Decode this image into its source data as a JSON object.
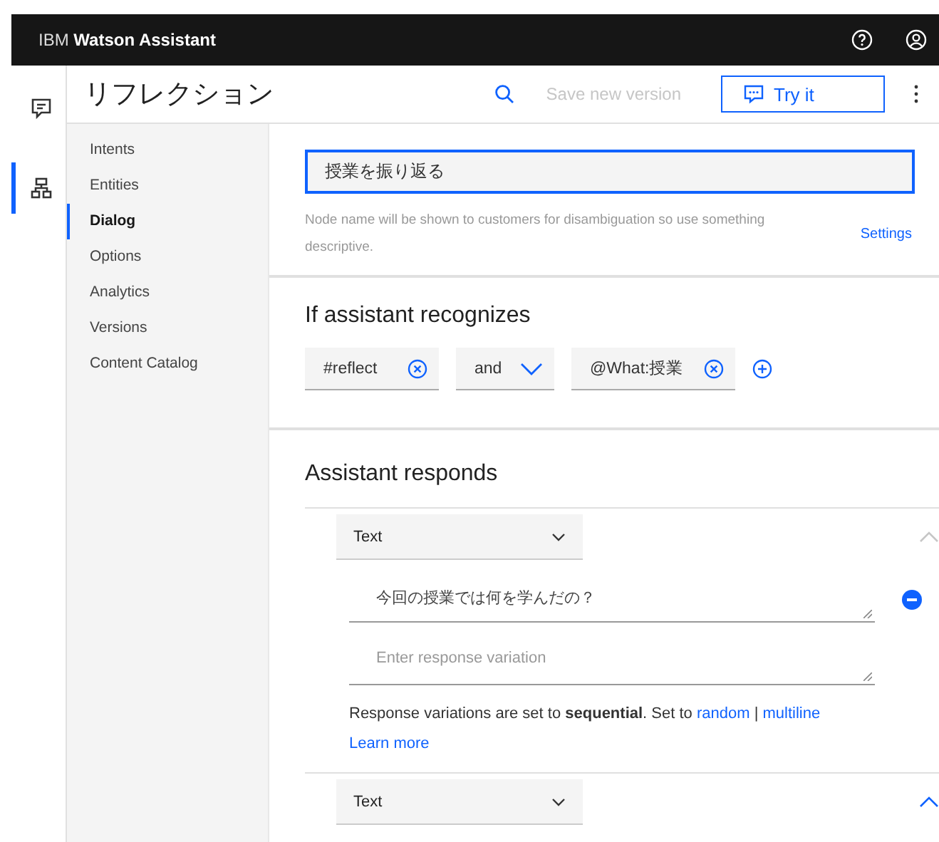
{
  "header": {
    "brand_prefix": "IBM",
    "brand_name": "Watson Assistant"
  },
  "toolbar": {
    "title": "リフレクション",
    "save_button": {
      "label": "Save new version",
      "disabled": true
    },
    "try_button": "Try it"
  },
  "rail": [
    {
      "kind": "chat",
      "selected": false
    },
    {
      "kind": "tree",
      "selected": true
    }
  ],
  "nav": [
    {
      "label": "Intents",
      "selected": false
    },
    {
      "label": "Entities",
      "selected": false
    },
    {
      "label": "Dialog",
      "selected": true
    },
    {
      "label": "Options",
      "selected": false
    },
    {
      "label": "Analytics",
      "selected": false
    },
    {
      "label": "Versions",
      "selected": false
    },
    {
      "label": "Content Catalog",
      "selected": false
    }
  ],
  "node_name": {
    "value": "授業を振り返る",
    "focused": true
  },
  "helper": "Node name will be shown to customers for disambiguation so use something descriptive.",
  "settings_link": "Settings",
  "conditions": {
    "heading": "If assistant recognizes",
    "items": [
      {
        "kind": "chip",
        "text": "#reflect"
      },
      {
        "kind": "select",
        "text": "and"
      },
      {
        "kind": "chip",
        "text": "@What:授業"
      }
    ]
  },
  "responds": {
    "heading": "Assistant responds",
    "responses": [
      {
        "type_label": "Text",
        "highlighted": false,
        "variations": [
          "今回の授業では何を学んだの？"
        ],
        "placeholder": "Enter response variation",
        "note": "Response variations are set to **sequential**. Set to",
        "links": [
          "random",
          "multiline"
        ],
        "separator": "|",
        "learn_more": "Learn more"
      },
      {
        "type_label": "Text",
        "highlighted": true
      }
    ]
  }
}
